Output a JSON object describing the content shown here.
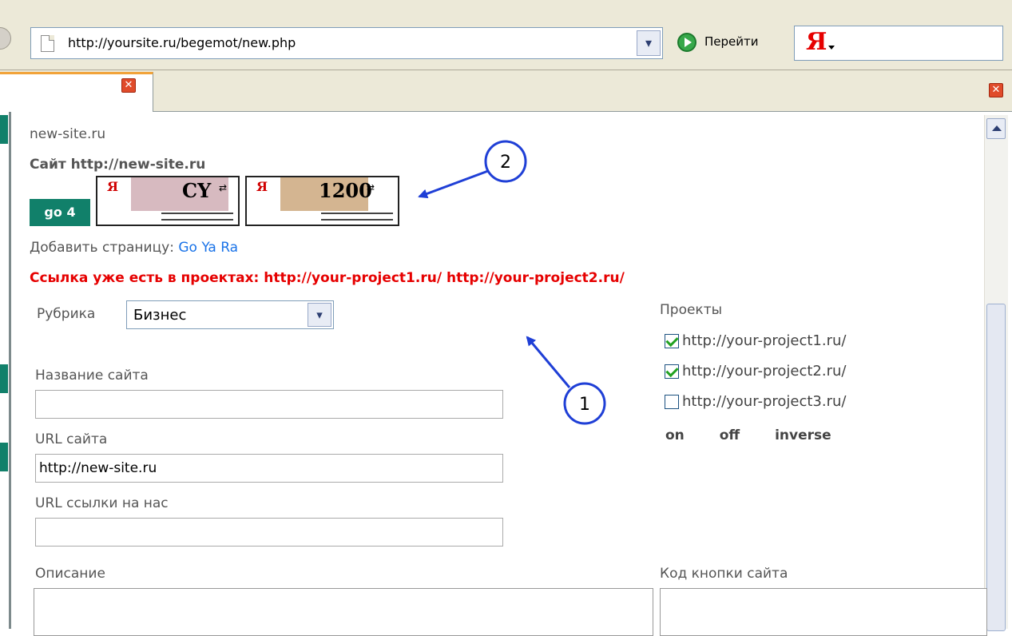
{
  "toolbar": {
    "url": "http://yoursite.ru/begemot/new.php",
    "go_label": "Перейти",
    "search_logo": "Я"
  },
  "tabs": {
    "close_glyph": "✕"
  },
  "content": {
    "site_domain": "new-site.ru",
    "site_title": "Сайт http://new-site.ru",
    "go_button": "go 4",
    "badges": [
      {
        "logo": "Я",
        "value": "CY"
      },
      {
        "logo": "Я",
        "value": "1200"
      }
    ],
    "add_page_label": "Добавить страницу:",
    "add_page_links": [
      "Go",
      "Ya",
      "Ra"
    ],
    "already_in_projects": "Ссылка уже есть в проектах: http://your-project1.ru/ http://your-project2.ru/",
    "rubric_label": "Рубрика",
    "rubric_value": "Бизнес",
    "projects_label": "Проекты",
    "projects": [
      {
        "url": "http://your-project1.ru/",
        "checked": true
      },
      {
        "url": "http://your-project2.ru/",
        "checked": true
      },
      {
        "url": "http://your-project3.ru/",
        "checked": false
      }
    ],
    "project_controls": [
      "on",
      "off",
      "inverse"
    ],
    "site_name_label": "Название сайта",
    "site_name_value": "",
    "site_url_label": "URL сайта",
    "site_url_value": "http://new-site.ru",
    "backlink_label": "URL ссылки на нас",
    "backlink_value": "",
    "description_label": "Описание",
    "button_code_label": "Код кнопки сайта"
  },
  "annotations": {
    "marker_1": "1",
    "marker_2": "2",
    "arrow_color": "#1f3fd6"
  }
}
